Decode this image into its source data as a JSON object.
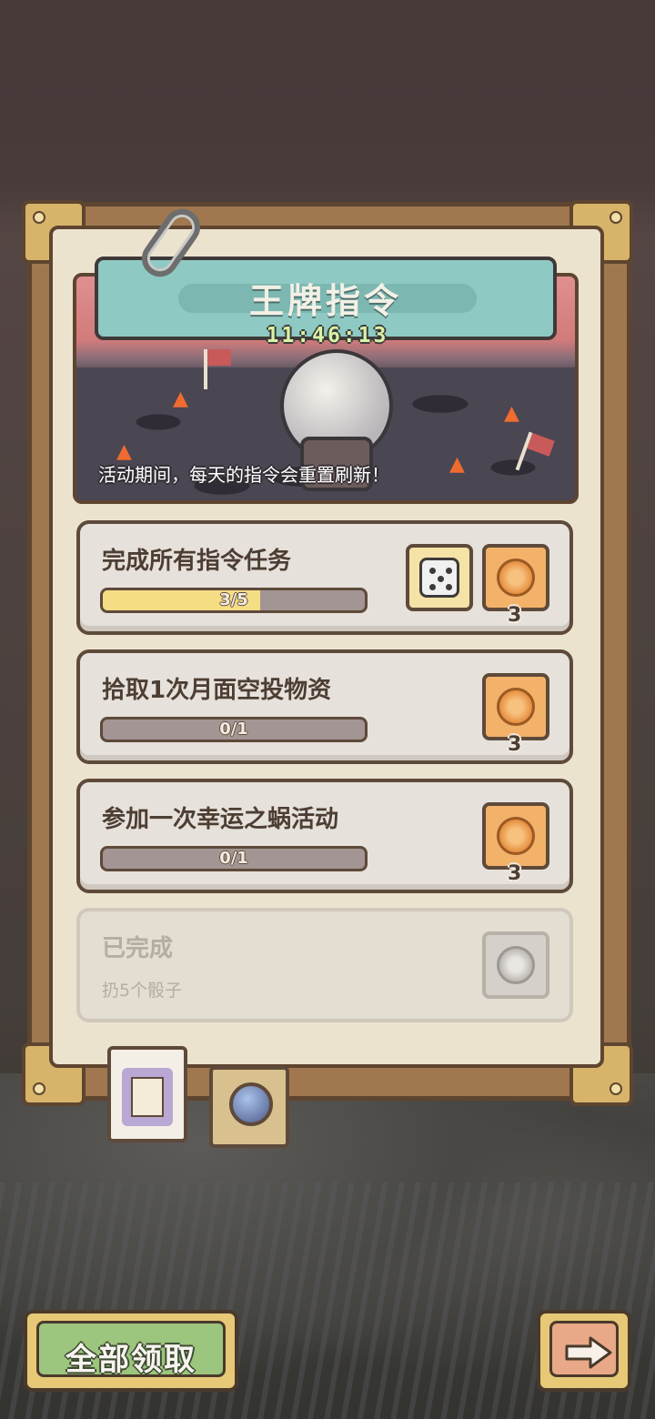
{
  "header": {
    "title": "王牌指令",
    "timer": "11:46:13",
    "notice": "活动期间，每天的指令会重置刷新！"
  },
  "tasks": [
    {
      "title": "完成所有指令任务",
      "progress_text": "3/5",
      "progress": 0.6,
      "rewards": [
        {
          "icon": "dice-icon",
          "count": ""
        },
        {
          "icon": "mooncake-icon",
          "count": "3"
        }
      ]
    },
    {
      "title": "拾取1次月面空投物资",
      "progress_text": "0/1",
      "progress": 0,
      "rewards": [
        {
          "icon": "mooncake-icon",
          "count": "3"
        }
      ]
    },
    {
      "title": "参加一次幸运之蜗活动",
      "progress_text": "0/1",
      "progress": 0,
      "rewards": [
        {
          "icon": "mooncake-icon",
          "count": "3"
        }
      ]
    },
    {
      "title": "已完成",
      "subtitle": "扔5个骰子",
      "status": "completed",
      "rewards": [
        {
          "icon": "mooncake-icon",
          "count": ""
        }
      ]
    }
  ],
  "tabs": [
    {
      "icon": "scroll-icon",
      "selected": true
    },
    {
      "icon": "globe-icon",
      "selected": false
    }
  ],
  "buttons": {
    "claim_all": "全部领取",
    "next": "arrow-right-icon"
  },
  "colors": {
    "banner_teal": "#8fc9c3",
    "progress_fill": "#f5dd84",
    "claim_green": "#9cc57e",
    "reward_orange": "#f3b26a"
  }
}
